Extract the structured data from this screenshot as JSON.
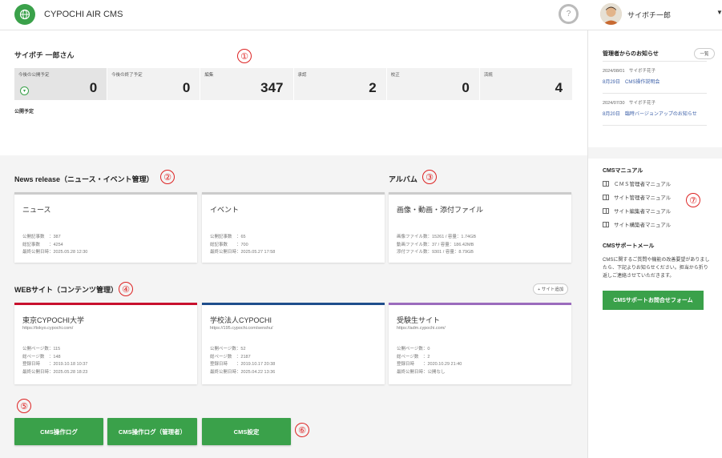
{
  "header": {
    "app_title": "CYPOCHI AIR CMS",
    "help": "?",
    "user_name": "サイボチ一郎",
    "caret": "▼"
  },
  "dashboard": {
    "greeting": "サイボチ 一郎さん",
    "stats": [
      {
        "label": "今後の公開予定",
        "value": "0"
      },
      {
        "label": "今後の終了予定",
        "value": "0"
      },
      {
        "label": "編集",
        "value": "347"
      },
      {
        "label": "承認",
        "value": "2"
      },
      {
        "label": "校正",
        "value": "0"
      },
      {
        "label": "済統",
        "value": "4"
      }
    ],
    "toggle": "▾",
    "scheduled_label": "公開予定"
  },
  "annotations": {
    "a1": "①",
    "a2": "②",
    "a3": "③",
    "a4": "④",
    "a5": "⑤",
    "a6": "⑥",
    "a7": "⑦"
  },
  "news_release": {
    "title": "News release（ニュース・イベント管理）",
    "cards": [
      {
        "title": "ニュース",
        "meta": "公開記事数　：387\n総記事数　　：4254\n最終公開日時：2025.05.28 12:30"
      },
      {
        "title": "イベント",
        "meta": "公開記事数　：65\n総記事数　　：700\n最終公開日時：2025.05.27 17:58"
      }
    ]
  },
  "album": {
    "title": "アルバム",
    "card": {
      "title": "画像・動画・添付ファイル",
      "meta": "画像ファイル数：15261 / 容量：1.74GB\n動画ファイル数：37 / 容量：186.42MB\n添付ファイル数：9301 / 容量：8.79GB"
    }
  },
  "websites": {
    "title": "WEBサイト（コンテンツ管理）",
    "add_label": "+ サイト追加",
    "cards": [
      {
        "title": "東京CYPOCHI大学",
        "url": "https://tokyo.cypochi.com/",
        "meta": "公開ページ数：115\n総ページ数　：148\n登録日時　　：2019.10.18 10:37\n最終公開日時：2025.05.28 18:23",
        "color": "#c8102e"
      },
      {
        "title": "学校法人CYPOCHI",
        "url": "https://195.cypochi.com/senshu/",
        "meta": "公開ページ数：52\n総ページ数　：2187\n登録日時　　：2019.10.17 20:38\n最終公開日時：2025.04.22 13:36",
        "color": "#1f4e8c"
      },
      {
        "title": "受験生サイト",
        "url": "https://adm.cypochi.com/",
        "meta": "公開ページ数：0\n総ページ数　：2\n登録日時　　：2020.10.29 21:40\n最終公開日時：公開なし",
        "color": "#9b6bbd"
      }
    ]
  },
  "actions": {
    "op_log": "CMS操作ログ",
    "op_log_admin": "CMS操作ログ（管理者）",
    "settings": "CMS設定"
  },
  "sidebar": {
    "notice_title": "管理者からのお知らせ",
    "list_button": "一覧",
    "notices": [
      {
        "date": "2024/08/01　サイボチ花子",
        "title": "8月29日　CMS操作説明会"
      },
      {
        "date": "2024/07/30　サイボチ花子",
        "title": "8月20日　臨時バージョンアップのお知らせ"
      }
    ],
    "manual_title": "CMSマニュアル",
    "manuals": [
      "ＣＭＳ管理者マニュアル",
      "サイト管理者マニュアル",
      "サイト編集者マニュアル",
      "サイト構築者マニュアル"
    ],
    "support_title": "CMSサポートメール",
    "support_text": "CMSに関するご質問や機能の改善要望がありましたら、下記よりお知らせください。担当から折り返しご連絡させていただきます。",
    "support_button": "CMSサポートお問合せフォーム"
  },
  "colors": {
    "accent": "#3aa14a",
    "link": "#3b5fa8",
    "annotation": "#dd2222"
  }
}
